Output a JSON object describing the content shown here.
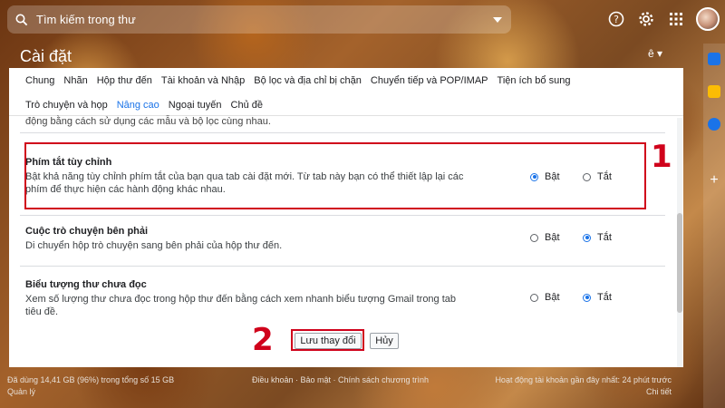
{
  "search": {
    "placeholder": "Tìm kiếm trong thư"
  },
  "header": {
    "title": "Cài đặt",
    "language": "ê"
  },
  "tabs_row1": [
    "Chung",
    "Nhãn",
    "Hộp thư đến",
    "Tài khoản và Nhập",
    "Bộ lọc và địa chỉ bị chặn",
    "Chuyển tiếp và POP/IMAP",
    "Tiện ích bổ sung"
  ],
  "tabs_row2": [
    "Trò chuyện và họp",
    "Nâng cao",
    "Ngoại tuyến",
    "Chủ đề"
  ],
  "active_tab": "Nâng cao",
  "prev_text": "động bằng cách sử dụng các mẫu và bộ lọc cùng nhau.",
  "settings": [
    {
      "title": "Phím tắt tùy chỉnh",
      "desc_lines": [
        "Bật khả năng tùy chỉnh phím tắt của bạn qua tab cài đặt mới. Từ tab này bạn có thể thiết lập lại các",
        "phím để thực hiện các hành động khác nhau."
      ],
      "on_label": "Bật",
      "off_label": "Tắt",
      "selected": "on"
    },
    {
      "title": "Cuộc trò chuyện bên phải",
      "desc_lines": [
        "Di chuyển hộp trò chuyện sang bên phải của hộp thư đến."
      ],
      "on_label": "Bật",
      "off_label": "Tắt",
      "selected": "off"
    },
    {
      "title": "Biểu tượng thư chưa đọc",
      "desc_lines": [
        "Xem số lượng thư chưa đọc trong hộp thư đến bằng cách xem nhanh biểu tượng Gmail trong tab",
        "tiêu đề."
      ],
      "on_label": "Bật",
      "off_label": "Tắt",
      "selected": "off"
    }
  ],
  "buttons": {
    "save": "Lưu thay đổi",
    "cancel": "Hủy"
  },
  "annotations": {
    "one": "1",
    "two": "2"
  },
  "footer": {
    "storage_line1": "Đã dùng 14,41 GB (96%) trong tổng số 15 GB",
    "storage_line2": "Quản lý",
    "links": "Điều khoản · Bảo mật · Chính sách chương trình",
    "activity_line1": "Hoạt động tài khoản gần đây nhất: 24 phút trước",
    "activity_line2": "Chi tiết"
  },
  "colors": {
    "accent": "#1a73e8",
    "annotation": "#d0021b"
  },
  "icons": [
    "search-icon",
    "dropdown-icon",
    "help-icon",
    "gear-icon",
    "apps-icon",
    "avatar",
    "calendar-icon",
    "keep-icon",
    "tasks-icon",
    "plus-icon"
  ]
}
